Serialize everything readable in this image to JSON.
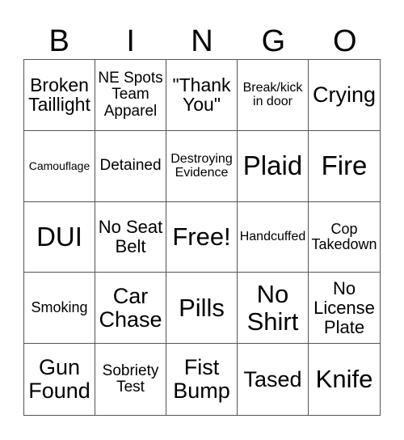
{
  "header": [
    "B",
    "I",
    "N",
    "G",
    "O"
  ],
  "cells": [
    "Broken Taillight",
    "NE Spots Team Apparel",
    "\"Thank You\"",
    "Break/kick in door",
    "Crying",
    "Camouflage",
    "Detained",
    "Destroying Evidence",
    "Plaid",
    "Fire",
    "DUI",
    "No Seat Belt",
    "Free!",
    "Handcuffed",
    "Cop Takedown",
    "Smoking",
    "Car Chase",
    "Pills",
    "No Shirt",
    "No License Plate",
    "Gun Found",
    "Sobriety Test",
    "Fist Bump",
    "Tased",
    "Knife"
  ]
}
